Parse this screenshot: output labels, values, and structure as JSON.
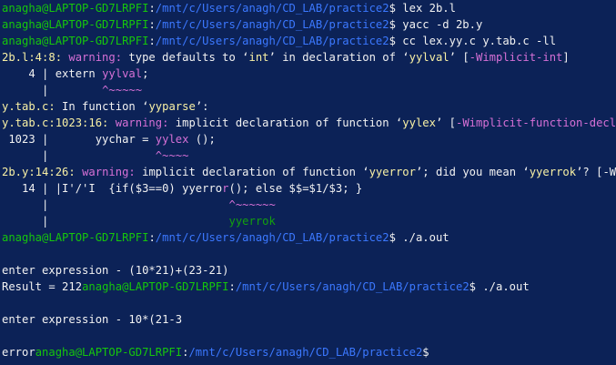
{
  "colors": {
    "background": "#0c2257",
    "prompt_user": "#16c60c",
    "path": "#3b78ff",
    "text": "#f2f2f2",
    "location": "#f9f1a5",
    "warning": "#d670d6",
    "suggestion": "#13a10e"
  },
  "terminal": {
    "lines": [
      [
        {
          "t": "anagha@LAPTOP-GD7LRPFI",
          "c": "g"
        },
        {
          "t": ":",
          "c": "w"
        },
        {
          "t": "/mnt/c/Users/anagh/CD_LAB/practice2",
          "c": "bl"
        },
        {
          "t": "$ lex 2b.l",
          "c": "w"
        }
      ],
      [
        {
          "t": "anagha@LAPTOP-GD7LRPFI",
          "c": "g"
        },
        {
          "t": ":",
          "c": "w"
        },
        {
          "t": "/mnt/c/Users/anagh/CD_LAB/practice2",
          "c": "bl"
        },
        {
          "t": "$ yacc -d 2b.y",
          "c": "w"
        }
      ],
      [
        {
          "t": "anagha@LAPTOP-GD7LRPFI",
          "c": "g"
        },
        {
          "t": ":",
          "c": "w"
        },
        {
          "t": "/mnt/c/Users/anagh/CD_LAB/practice2",
          "c": "bl"
        },
        {
          "t": "$ cc lex.yy.c y.tab.c -ll",
          "c": "w"
        }
      ],
      [
        {
          "t": "2b.l:4:8: ",
          "c": "y"
        },
        {
          "t": "warning: ",
          "c": "m"
        },
        {
          "t": "type defaults to ‘",
          "c": "w"
        },
        {
          "t": "int",
          "c": "y"
        },
        {
          "t": "’ in declaration of ‘",
          "c": "w"
        },
        {
          "t": "yylval",
          "c": "y"
        },
        {
          "t": "’ [",
          "c": "w"
        },
        {
          "t": "-Wimplicit-int",
          "c": "m"
        },
        {
          "t": "]",
          "c": "w"
        }
      ],
      [
        {
          "t": "    4 | extern ",
          "c": "w"
        },
        {
          "t": "yylval",
          "c": "m"
        },
        {
          "t": ";",
          "c": "w"
        }
      ],
      [
        {
          "t": "      |        ",
          "c": "w"
        },
        {
          "t": "^~~~~~",
          "c": "m"
        }
      ],
      [
        {
          "t": "y.tab.c:",
          "c": "y"
        },
        {
          "t": " In function ‘",
          "c": "w"
        },
        {
          "t": "yyparse",
          "c": "y"
        },
        {
          "t": "’:",
          "c": "w"
        }
      ],
      [
        {
          "t": "y.tab.c:1023:16: ",
          "c": "y"
        },
        {
          "t": "warning: ",
          "c": "m"
        },
        {
          "t": "implicit declaration of function ‘",
          "c": "w"
        },
        {
          "t": "yylex",
          "c": "y"
        },
        {
          "t": "’ [",
          "c": "w"
        },
        {
          "t": "-Wimplicit-function-declaration",
          "c": "m"
        },
        {
          "t": "]",
          "c": "w"
        }
      ],
      [
        {
          "t": " 1023 |       yychar = ",
          "c": "w"
        },
        {
          "t": "yylex",
          "c": "m"
        },
        {
          "t": " ();",
          "c": "w"
        }
      ],
      [
        {
          "t": "      |                ",
          "c": "w"
        },
        {
          "t": "^~~~~",
          "c": "m"
        }
      ],
      [
        {
          "t": "2b.y:14:26: ",
          "c": "y"
        },
        {
          "t": "warning: ",
          "c": "m"
        },
        {
          "t": "implicit declaration of function ‘",
          "c": "w"
        },
        {
          "t": "yyerror",
          "c": "y"
        },
        {
          "t": "’; did you mean ‘",
          "c": "w"
        },
        {
          "t": "yyerrok",
          "c": "y"
        },
        {
          "t": "’? [-Wimplicit-function-declaration]",
          "c": "w"
        }
      ],
      [
        {
          "t": "   14 | |I'/'I  {if($3==0) yyerro",
          "c": "w"
        },
        {
          "t": "r",
          "c": "m"
        },
        {
          "t": "(); else $$=$1/$3; }",
          "c": "w"
        }
      ],
      [
        {
          "t": "      |                           ",
          "c": "w"
        },
        {
          "t": "^~~~~~~",
          "c": "m"
        }
      ],
      [
        {
          "t": "      |                           ",
          "c": "w"
        },
        {
          "t": "yyerrok",
          "c": "gn"
        }
      ],
      [
        {
          "t": "anagha@LAPTOP-GD7LRPFI",
          "c": "g"
        },
        {
          "t": ":",
          "c": "w"
        },
        {
          "t": "/mnt/c/Users/anagh/CD_LAB/practice2",
          "c": "bl"
        },
        {
          "t": "$ ./a.out",
          "c": "w"
        }
      ],
      [],
      [
        {
          "t": "enter expression - (10*21)+(23-21)",
          "c": "w"
        }
      ],
      [
        {
          "t": "Result = 212",
          "c": "w"
        },
        {
          "t": "anagha@LAPTOP-GD7LRPFI",
          "c": "g"
        },
        {
          "t": ":",
          "c": "w"
        },
        {
          "t": "/mnt/c/Users/anagh/CD_LAB/practice2",
          "c": "bl"
        },
        {
          "t": "$ ./a.out",
          "c": "w"
        }
      ],
      [],
      [
        {
          "t": "enter expression - 10*(21-3",
          "c": "w"
        }
      ],
      [],
      [
        {
          "t": "error",
          "c": "w"
        },
        {
          "t": "anagha@LAPTOP-GD7LRPFI",
          "c": "g"
        },
        {
          "t": ":",
          "c": "w"
        },
        {
          "t": "/mnt/c/Users/anagh/CD_LAB/practice2",
          "c": "bl"
        },
        {
          "t": "$",
          "c": "w"
        }
      ]
    ]
  }
}
